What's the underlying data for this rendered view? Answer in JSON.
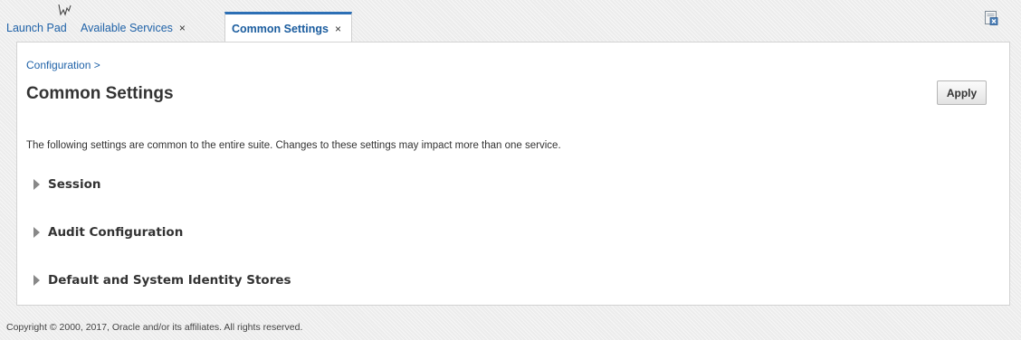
{
  "tabs": [
    {
      "label": "Launch Pad",
      "closable": false,
      "active": false
    },
    {
      "label": "Available Services",
      "close_glyph": "×",
      "active": false
    },
    {
      "label": "Common Settings",
      "close_glyph": "×",
      "active": true
    }
  ],
  "breadcrumb": "Configuration >",
  "page_title": "Common Settings",
  "apply_label": "Apply",
  "description": "The following settings are common to the entire suite. Changes to these settings may impact more than one service.",
  "sections": [
    {
      "label": "Session",
      "expanded": false
    },
    {
      "label": "Audit Configuration",
      "expanded": false
    },
    {
      "label": "Default and System Identity Stores",
      "expanded": false
    }
  ],
  "footer": "Copyright © 2000, 2017, Oracle and/or its affiliates. All rights reserved.",
  "icons": {
    "cursor": "pointer-cursor-icon",
    "window_close": "close-window-icon",
    "section_toggle": "disclosure-triangle-icon"
  },
  "colors": {
    "link": "#1f62a8",
    "active_tab_border": "#2c6fb5",
    "text": "#333333"
  }
}
